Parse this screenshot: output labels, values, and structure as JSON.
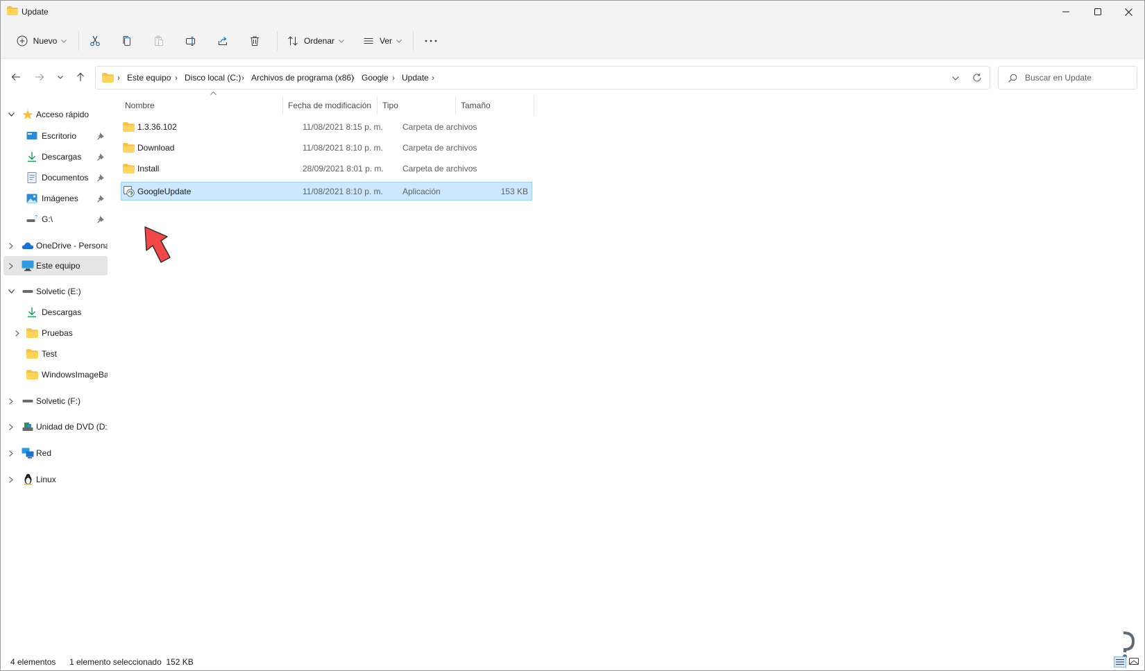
{
  "window": {
    "title": "Update"
  },
  "toolbar": {
    "new_label": "Nuevo",
    "sort_label": "Ordenar",
    "view_label": "Ver",
    "more_label": "···"
  },
  "address": {
    "breadcrumbs": [
      "Este equipo",
      "Disco local (C:)",
      "Archivos de programa (x86)",
      "Google",
      "Update"
    ]
  },
  "search": {
    "placeholder": "Buscar en Update"
  },
  "sidebar": {
    "quick_access": "Acceso rápido",
    "quick_items": [
      "Escritorio",
      "Descargas",
      "Documentos",
      "Imágenes",
      "G:\\"
    ],
    "onedrive": "OneDrive - Personal",
    "this_pc": "Este equipo",
    "drive_e": "Solvetic (E:)",
    "drive_e_items": [
      "Descargas",
      "Pruebas",
      "Test",
      "WindowsImageBa"
    ],
    "drive_f": "Solvetic (F:)",
    "dvd": "Unidad de DVD (D:)",
    "network": "Red",
    "linux": "Linux"
  },
  "columns": {
    "name": "Nombre",
    "modified": "Fecha de modificación",
    "type": "Tipo",
    "size": "Tamaño"
  },
  "files": [
    {
      "name": "1.3.36.102",
      "modified": "11/08/2021 8:15 p. m.",
      "type": "Carpeta de archivos",
      "size": ""
    },
    {
      "name": "Download",
      "modified": "11/08/2021 8:10 p. m.",
      "type": "Carpeta de archivos",
      "size": ""
    },
    {
      "name": "Install",
      "modified": "28/09/2021 8:01 p. m.",
      "type": "Carpeta de archivos",
      "size": ""
    },
    {
      "name": "GoogleUpdate",
      "modified": "11/08/2021 8:10 p. m.",
      "type": "Aplicación",
      "size": "153 KB"
    }
  ],
  "status": {
    "count": "4 elementos",
    "selection": "1 elemento seleccionado  152 KB"
  },
  "colors": {
    "accent": "#0067c0",
    "folder": "#f8c13e",
    "selected_row": "#cce8ff",
    "arrow": "#f24747"
  }
}
